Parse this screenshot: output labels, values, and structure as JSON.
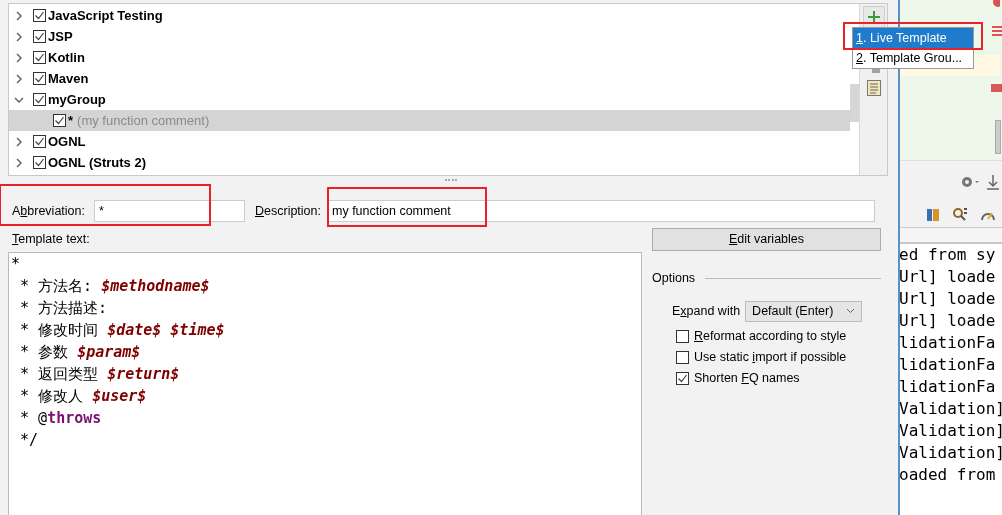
{
  "tree": [
    {
      "label": "JavaScript Testing",
      "expanded": false,
      "checked": true
    },
    {
      "label": "JSP",
      "expanded": false,
      "checked": true
    },
    {
      "label": "Kotlin",
      "expanded": false,
      "checked": true
    },
    {
      "label": "Maven",
      "expanded": false,
      "checked": true
    },
    {
      "label": "myGroup",
      "expanded": true,
      "checked": true,
      "children": [
        {
          "abbreviation": "*",
          "description": "(my function comment)",
          "checked": true,
          "selected": true
        }
      ]
    },
    {
      "label": "OGNL",
      "expanded": false,
      "checked": true
    },
    {
      "label": "OGNL (Struts 2)",
      "expanded": false,
      "checked": true
    }
  ],
  "add_menu": [
    {
      "mnemonic": "1",
      "label": ". Live Template",
      "selected": true,
      "highlighted": true
    },
    {
      "mnemonic": "2",
      "label": ". Template Grou...",
      "selected": false,
      "highlighted": false
    }
  ],
  "abbreviation": {
    "label_before": "A",
    "mnemonic": "b",
    "label_after": "breviation:",
    "value": "*",
    "highlighted": true
  },
  "description": {
    "mnemonic": "D",
    "label_after": "escription:",
    "value": "my function comment",
    "highlighted": true
  },
  "template_text": {
    "mnemonic": "T",
    "label_after": "emplate text:",
    "lines": [
      [
        {
          "kind": "plain",
          "text": "*"
        }
      ],
      [
        {
          "kind": "plain",
          "text": " * 方法名: "
        },
        {
          "kind": "variable",
          "text": "$methodname$"
        }
      ],
      [
        {
          "kind": "plain",
          "text": " * 方法描述:"
        }
      ],
      [
        {
          "kind": "plain",
          "text": " * 修改时间 "
        },
        {
          "kind": "variable",
          "text": "$date$ $time$"
        }
      ],
      [
        {
          "kind": "plain",
          "text": " * 参数 "
        },
        {
          "kind": "variable",
          "text": "$param$"
        }
      ],
      [
        {
          "kind": "plain",
          "text": " * 返回类型 "
        },
        {
          "kind": "variable",
          "text": "$return$"
        }
      ],
      [
        {
          "kind": "plain",
          "text": " * 修改人 "
        },
        {
          "kind": "variable",
          "text": "$user$"
        }
      ],
      [
        {
          "kind": "plain",
          "text": " * @"
        },
        {
          "kind": "keyword",
          "text": "throws"
        }
      ],
      [
        {
          "kind": "plain",
          "text": " */"
        }
      ]
    ]
  },
  "edit_variables": {
    "mnemonic": "E",
    "label_after": "dit variables"
  },
  "options": {
    "title": "Options",
    "expand_with": {
      "label_before": "E",
      "mnemonic": "x",
      "label_after": "pand with",
      "value": "Default (Enter)"
    },
    "checkboxes": [
      {
        "mnemonic": "R",
        "label_after": "eformat according to style",
        "checked": false
      },
      {
        "label_before": "Use static ",
        "mnemonic": "i",
        "label_after": "mport if possible",
        "checked": false
      },
      {
        "label_before": "Shorten ",
        "mnemonic": "F",
        "label_after": "Q names",
        "checked": true
      }
    ]
  },
  "console_lines": [
    "ed from sy",
    "Url] loade",
    "Url] loade",
    "Url] loade",
    "lidationFa",
    "lidationFa",
    "lidationFa",
    "Validation]",
    "Validation]",
    "Validation]",
    "oaded from"
  ]
}
